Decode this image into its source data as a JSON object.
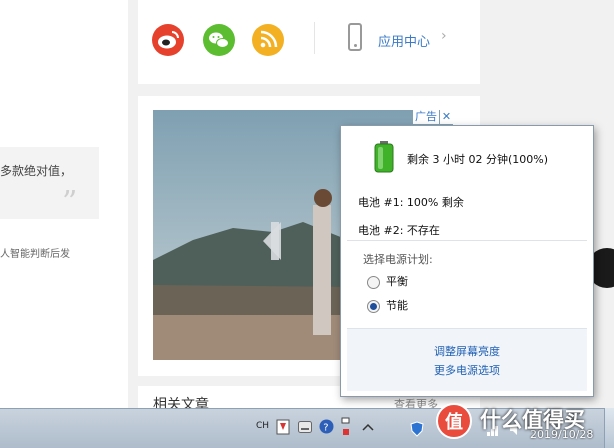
{
  "page": {
    "quote_text": "多款绝对值，",
    "side_text": "人智能判断后发",
    "share": {
      "app_center_label": "应用中心",
      "chevron": "›"
    },
    "ad": {
      "badge": "广告",
      "close": "✕"
    },
    "related": {
      "title": "相关文章",
      "more": "查看更多"
    }
  },
  "battery_flyout": {
    "status": "剩余 3 小时 02 分钟(100%)",
    "battery1": "电池 #1: 100% 剩余",
    "battery2": "电池 #2: 不存在",
    "plan_label": "选择电源计划:",
    "plans": [
      {
        "label": "平衡",
        "selected": false
      },
      {
        "label": "节能",
        "selected": true
      }
    ],
    "link_brightness": "调整屏幕亮度",
    "link_more": "更多电源选项",
    "battery_level": 1.0
  },
  "taskbar": {
    "ime": "CH",
    "clock_date": "2019/10/28",
    "watermark": "什么值得买"
  },
  "colors": {
    "link": "#1f5fb2",
    "weibo": "#e6412c",
    "wechat": "#5bbd2f",
    "rss": "#f3b022",
    "battery_green": "#3fb22a"
  },
  "icons": [
    "weibo-icon",
    "wechat-icon",
    "rss-icon",
    "phone-icon",
    "battery-icon",
    "play-icon",
    "help-icon",
    "flag-icon",
    "shield-icon",
    "network-icon",
    "volume-icon"
  ]
}
